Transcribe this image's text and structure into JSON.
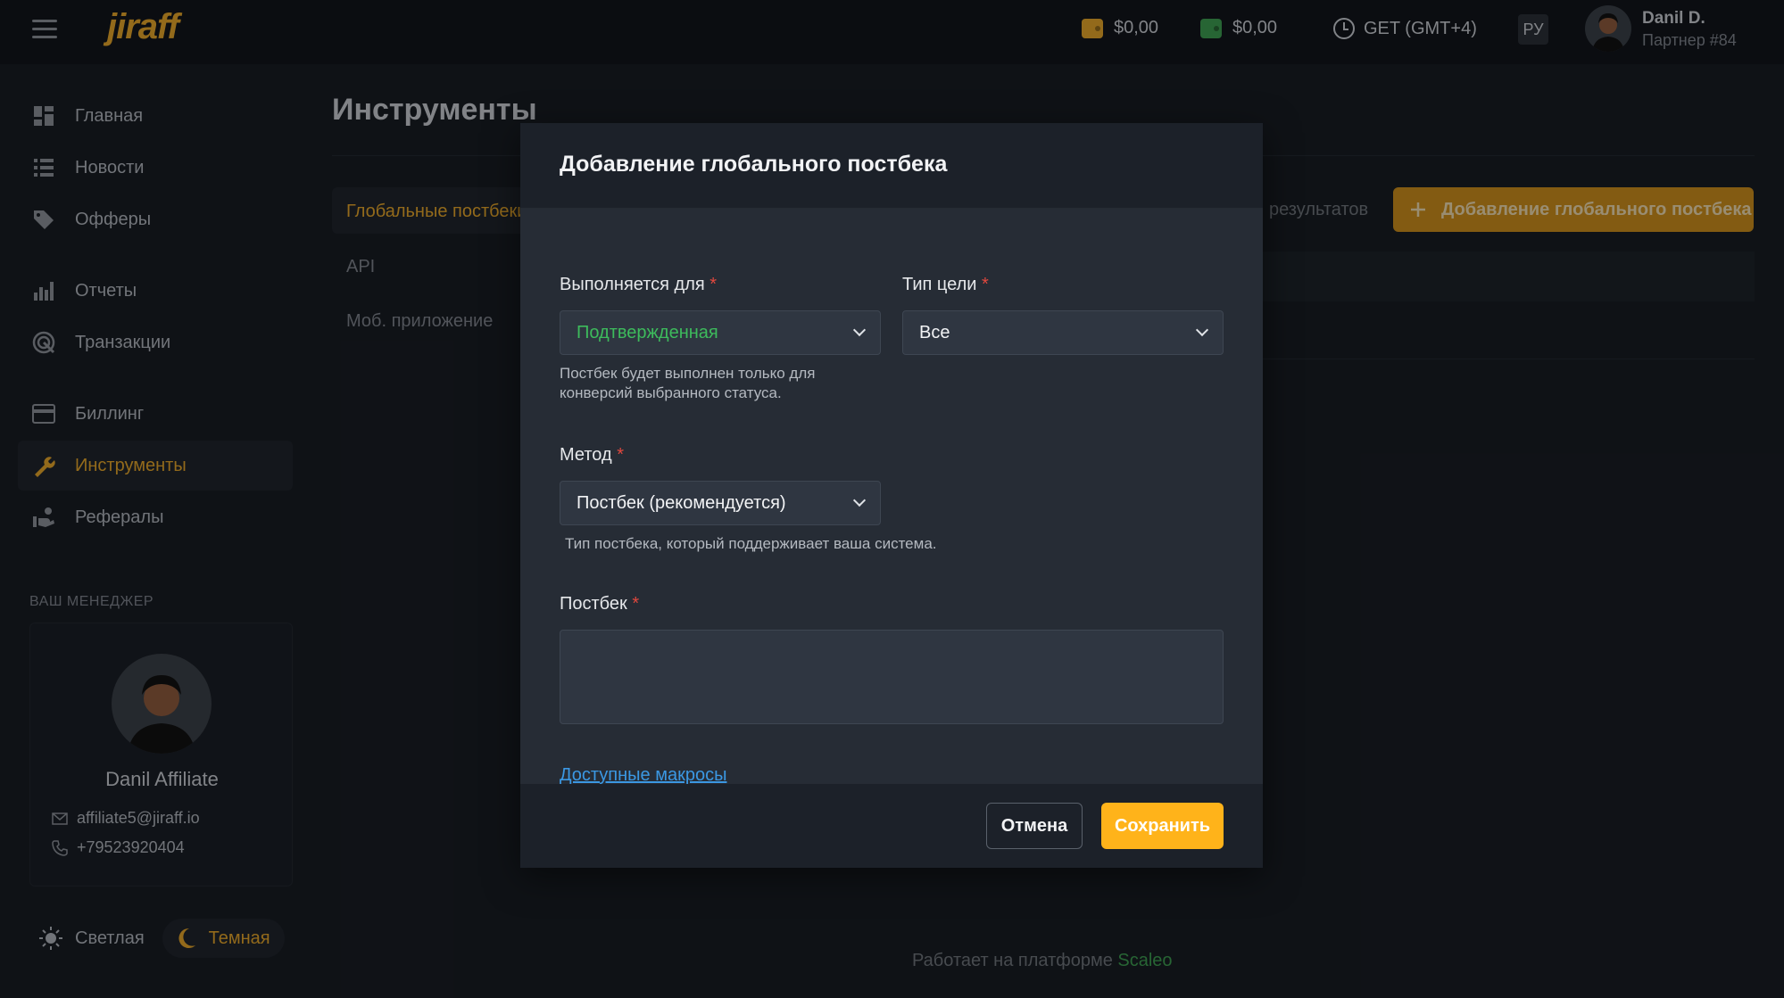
{
  "header": {
    "logo": "jiraff",
    "balance1": "$0,00",
    "balance2": "$0,00",
    "timezone": "GET (GMT+4)",
    "lang": "РУ",
    "user_name": "Danil D.",
    "user_sub": "Партнер #84"
  },
  "sidebar": {
    "items": [
      {
        "label": "Главная",
        "icon": "dashboard-icon"
      },
      {
        "label": "Новости",
        "icon": "news-icon"
      },
      {
        "label": "Офферы",
        "icon": "tag-icon"
      },
      {
        "label": "Отчеты",
        "icon": "bar-chart-icon"
      },
      {
        "label": "Транзакции",
        "icon": "transactions-icon"
      },
      {
        "label": "Биллинг",
        "icon": "credit-card-icon"
      },
      {
        "label": "Инструменты",
        "icon": "wrench-icon"
      },
      {
        "label": "Рефералы",
        "icon": "referrals-icon"
      }
    ],
    "manager_section": "ВАШ МЕНЕДЖЕР",
    "manager": {
      "name": "Danil Affiliate",
      "email": "affiliate5@jiraff.io",
      "phone": "+79523920404"
    },
    "theme": {
      "light": "Светлая",
      "dark": "Темная"
    }
  },
  "main": {
    "title": "Инструменты",
    "tabs": [
      "Глобальные постбеки",
      "API",
      "Моб. приложение"
    ],
    "results_text": "результатов",
    "add_button": "Добавление глобального постбека",
    "footer_prefix": "Работает на платформе ",
    "footer_brand": "Scaleo"
  },
  "modal": {
    "title": "Добавление глобального постбека",
    "executes_for": {
      "label": "Выполняется для",
      "value": "Подтвержденная",
      "hint": "Постбек будет выполнен только для конверсий выбранного статуса."
    },
    "goal_type": {
      "label": "Тип цели",
      "value": "Все"
    },
    "method": {
      "label": "Метод",
      "value": "Постбек (рекомендуется)",
      "hint": "Тип постбека, который поддерживает ваша система."
    },
    "postback": {
      "label": "Постбек",
      "value": ""
    },
    "macros_link": "Доступные макросы",
    "cancel": "Отмена",
    "save": "Сохранить"
  },
  "colors": {
    "accent": "#ffb31a",
    "success": "#3dbb5c",
    "link": "#3b98e3",
    "required": "#e0483e"
  }
}
